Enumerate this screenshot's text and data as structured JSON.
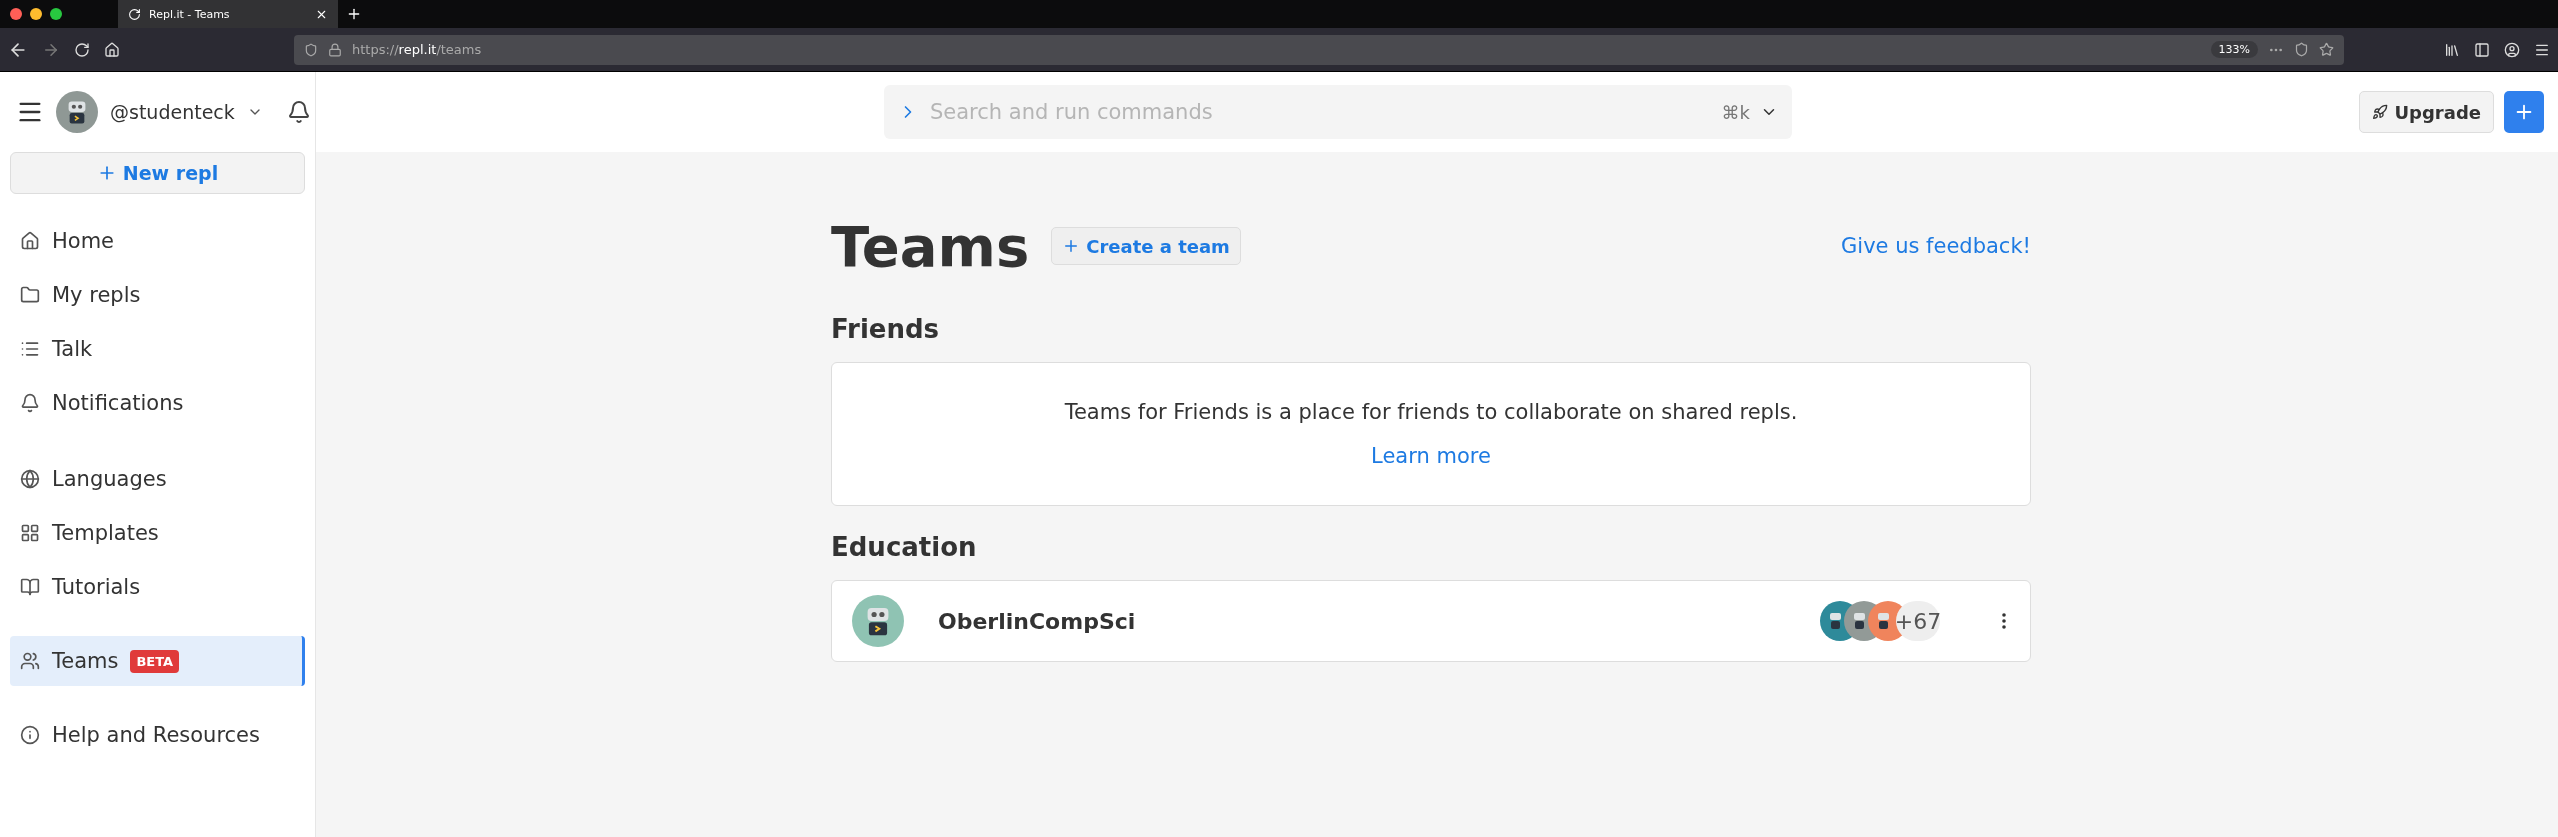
{
  "browser": {
    "tab_title": "Repl.it - Teams",
    "url_scheme": "https://",
    "url_host": "repl.it",
    "url_path": "/teams",
    "zoom": "133%"
  },
  "sidebar": {
    "username": "@studenteck",
    "new_repl": "New repl",
    "groups": [
      [
        {
          "label": "Home",
          "selected": false
        },
        {
          "label": "My repls",
          "selected": false
        },
        {
          "label": "Talk",
          "selected": false
        },
        {
          "label": "Notifications",
          "selected": false
        }
      ],
      [
        {
          "label": "Languages",
          "selected": false
        },
        {
          "label": "Templates",
          "selected": false
        },
        {
          "label": "Tutorials",
          "selected": false
        }
      ],
      [
        {
          "label": "Teams",
          "selected": true,
          "badge": "BETA"
        }
      ],
      [
        {
          "label": "Help and Resources",
          "selected": false
        }
      ]
    ]
  },
  "header": {
    "search_placeholder": "Search and run commands",
    "shortcut": "⌘k",
    "upgrade": "Upgrade"
  },
  "main": {
    "title": "Teams",
    "create_team": "Create a team",
    "feedback": "Give us feedback!",
    "sections": [
      {
        "kind": "info",
        "heading": "Friends",
        "text": "Teams for Friends is a place for friends to collaborate on shared repls.",
        "link": "Learn more"
      },
      {
        "kind": "teams",
        "heading": "Education",
        "teams": [
          {
            "name": "OberlinCompSci",
            "members": [
              {
                "color": "#2e8a9a"
              },
              {
                "color": "#929a97"
              },
              {
                "color": "#f0845c"
              }
            ],
            "more": "+67"
          }
        ]
      }
    ]
  }
}
